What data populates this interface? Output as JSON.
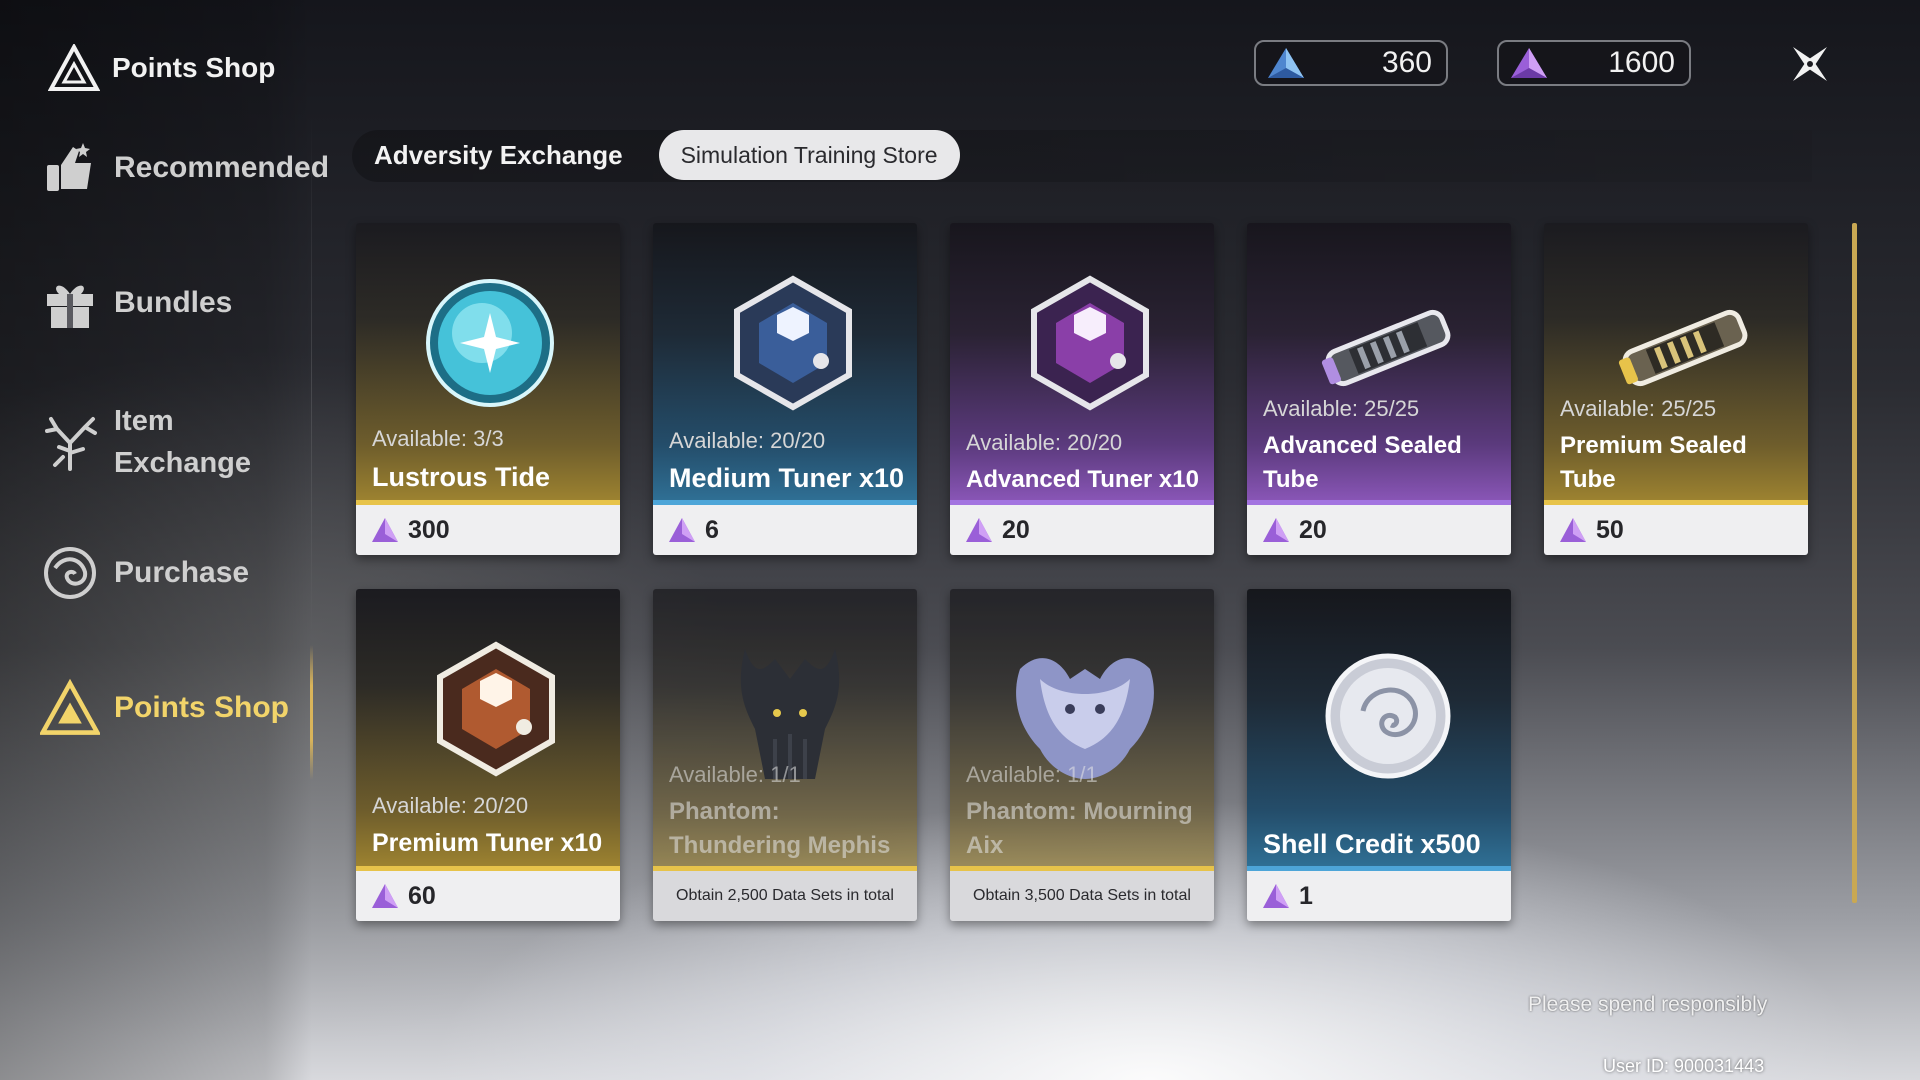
{
  "header": {
    "title": "Points Shop"
  },
  "currencies": [
    {
      "name": "adversity-points",
      "value": "360",
      "color": "#6aa7e6"
    },
    {
      "name": "training-points",
      "value": "1600",
      "color": "#b57be8"
    }
  ],
  "sidebar": {
    "items": [
      {
        "label": "Recommended",
        "icon": "recommended-icon",
        "active": false
      },
      {
        "label": "Bundles",
        "icon": "gift-icon",
        "active": false
      },
      {
        "label": "Item\nExchange",
        "icon": "coral-icon",
        "active": false
      },
      {
        "label": "Purchase",
        "icon": "shell-icon",
        "active": false
      },
      {
        "label": "Points Shop",
        "icon": "triangle-icon",
        "active": true
      }
    ]
  },
  "tabs": [
    {
      "label": "Adversity Exchange",
      "selected": false
    },
    {
      "label": "Simulation Training Store",
      "selected": true
    }
  ],
  "items": [
    {
      "available": "Available: 3/3",
      "name": "Lustrous Tide",
      "price": "300",
      "rarity": "gold",
      "icon": "lustrous-tide-icon"
    },
    {
      "available": "Available: 20/20",
      "name": "Medium Tuner x10",
      "price": "6",
      "rarity": "blue",
      "icon": "tuner-icon"
    },
    {
      "available": "Available: 20/20",
      "name": "Advanced Tuner x10",
      "price": "20",
      "rarity": "purple",
      "icon": "tuner-icon"
    },
    {
      "available": "Available: 25/25",
      "name": "Advanced Sealed Tube",
      "price": "20",
      "rarity": "purple",
      "icon": "sealed-tube-icon"
    },
    {
      "available": "Available: 25/25",
      "name": "Premium Sealed Tube",
      "price": "50",
      "rarity": "gold",
      "icon": "sealed-tube-icon"
    },
    {
      "available": "Available: 20/20",
      "name": "Premium Tuner x10",
      "price": "60",
      "rarity": "gold",
      "icon": "tuner-icon"
    },
    {
      "available": "Available: 1/1",
      "name": "Phantom: Thundering Mephis",
      "requirement": "Obtain 2,500 Data Sets in total",
      "rarity": "gold",
      "icon": "phantom-icon"
    },
    {
      "available": "Available: 1/1",
      "name": "Phantom: Mourning Aix",
      "requirement": "Obtain 3,500 Data Sets in total",
      "rarity": "gold",
      "icon": "phantom-icon"
    },
    {
      "available": "",
      "name": "Shell Credit x500",
      "price": "1",
      "rarity": "blue",
      "icon": "shell-credit-icon"
    }
  ],
  "footer": {
    "note": "Please spend responsibly",
    "user_id": "User ID: 900031443"
  }
}
